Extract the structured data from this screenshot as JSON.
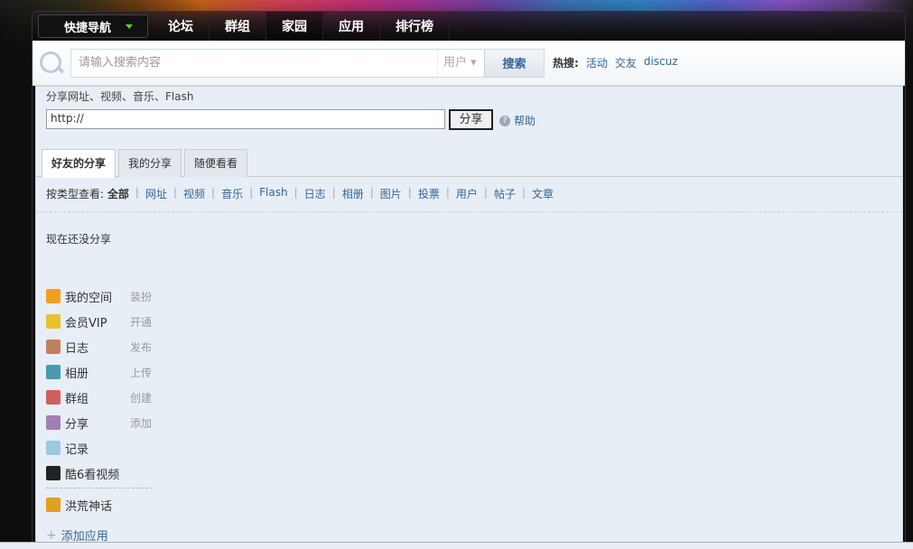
{
  "nav": {
    "quick": "快捷导航",
    "items": [
      "论坛",
      "群组",
      "家园",
      "应用",
      "排行榜"
    ]
  },
  "search": {
    "placeholder": "请输入搜索内容",
    "type": "用户",
    "button": "搜索",
    "hot_label": "热搜:",
    "hot": [
      "活动",
      "交友",
      "discuz"
    ]
  },
  "share": {
    "label": "分享网址、视频、音乐、Flash",
    "url": "http://",
    "button": "分享",
    "help": "帮助"
  },
  "tabs": [
    "好友的分享",
    "我的分享",
    "随便看看"
  ],
  "filter": {
    "label": "按类型查看:",
    "current": "全部",
    "types": [
      "网址",
      "视频",
      "音乐",
      "Flash",
      "日志",
      "相册",
      "图片",
      "投票",
      "用户",
      "帖子",
      "文章"
    ]
  },
  "empty": "现在还没分享",
  "apps": [
    {
      "name": "我的空间",
      "action": "装扮",
      "color": "#f0a020"
    },
    {
      "name": "会员VIP",
      "action": "开通",
      "color": "#e8c030"
    },
    {
      "name": "日志",
      "action": "发布",
      "color": "#c08060"
    },
    {
      "name": "相册",
      "action": "上传",
      "color": "#4a9ab0"
    },
    {
      "name": "群组",
      "action": "创建",
      "color": "#d06060"
    },
    {
      "name": "分享",
      "action": "添加",
      "color": "#a080b0"
    },
    {
      "name": "记录",
      "action": "",
      "color": "#9cc8e0"
    },
    {
      "name": "酷6看视频",
      "action": "",
      "color": "#222222"
    }
  ],
  "extra_app": {
    "name": "洪荒神话",
    "color": "#e0a020"
  },
  "add_app": "添加应用"
}
